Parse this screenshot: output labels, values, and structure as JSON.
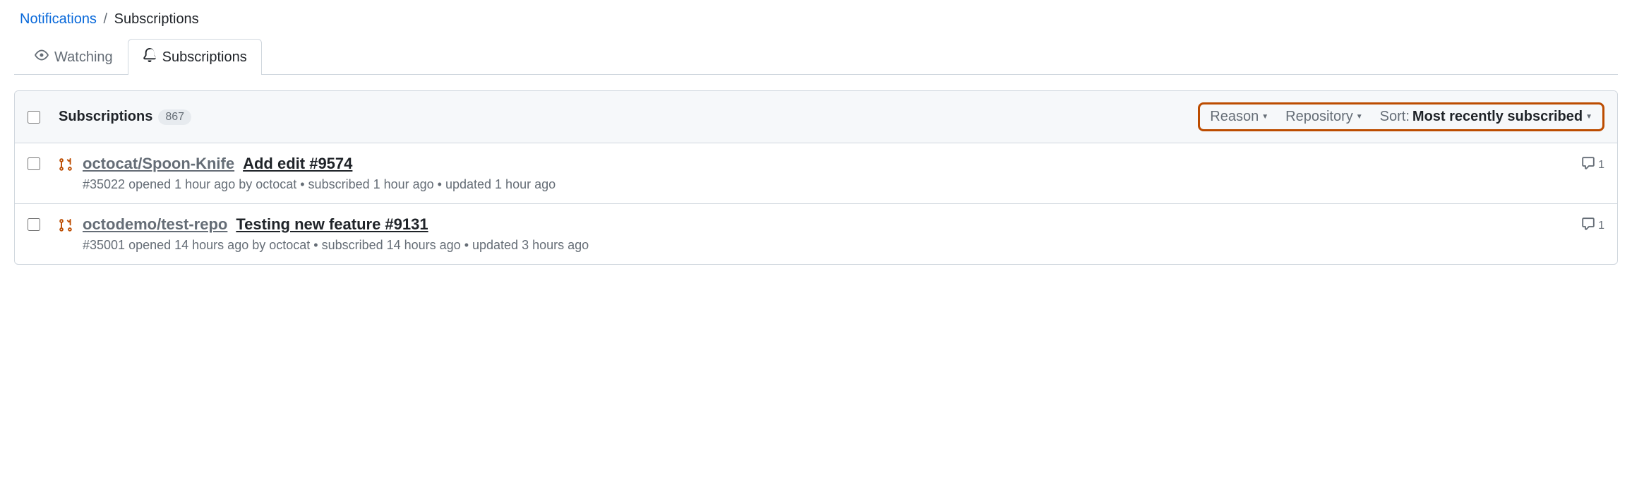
{
  "breadcrumb": {
    "parent": "Notifications",
    "separator": "/",
    "current": "Subscriptions"
  },
  "tabs": {
    "watching": "Watching",
    "subscriptions": "Subscriptions"
  },
  "header": {
    "title": "Subscriptions",
    "count": "867"
  },
  "filters": {
    "reason": "Reason",
    "repository": "Repository",
    "sort_label": "Sort:",
    "sort_value": "Most recently subscribed"
  },
  "items": [
    {
      "repo": "octocat/Spoon-Knife",
      "title": "Add edit #9574",
      "meta": "#35022 opened 1 hour ago by octocat • subscribed 1 hour ago • updated 1 hour ago",
      "comments": "1"
    },
    {
      "repo": "octodemo/test-repo",
      "title": "Testing new feature #9131",
      "meta": "#35001 opened 14 hours ago by octocat • subscribed 14 hours ago • updated 3 hours ago",
      "comments": "1"
    }
  ]
}
